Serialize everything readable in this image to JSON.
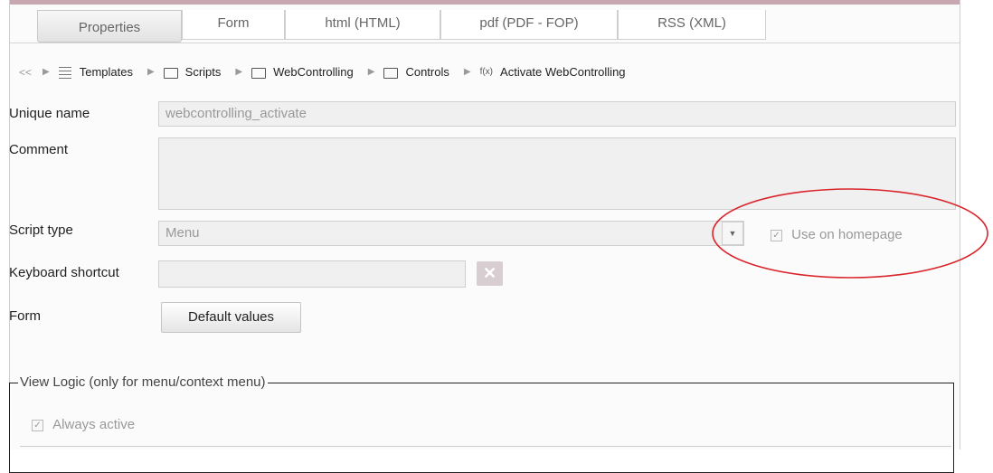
{
  "tabs": [
    "Properties",
    "Form",
    "html (HTML)",
    "pdf (PDF - FOP)",
    "RSS (XML)"
  ],
  "breadcrumb": {
    "nav_glyph": "<<",
    "items": [
      "Templates",
      "Scripts",
      "WebControlling",
      "Controls",
      "Activate WebControlling"
    ],
    "icons": [
      "templates-icon",
      "folder-icon",
      "folder-icon",
      "folder-icon",
      "script-icon"
    ],
    "fx_glyph": "f(x)"
  },
  "form": {
    "unique_name_label": "Unique name",
    "unique_name_value": "webcontrolling_activate",
    "comment_label": "Comment",
    "comment_value": "",
    "script_type_label": "Script type",
    "script_type_value": "Menu",
    "use_on_homepage_label": "Use on homepage",
    "use_on_homepage_checked": true,
    "keyboard_shortcut_label": "Keyboard shortcut",
    "keyboard_shortcut_value": "",
    "form_label": "Form",
    "default_values_button": "Default values"
  },
  "view_logic": {
    "legend": "View Logic (only for menu/context menu)",
    "always_active_label": "Always active",
    "always_active_checked": true
  },
  "colors": {
    "top_accent": "#c9a7b1",
    "annotation_ellipse": "#d9252b",
    "clear_button": "#d8cdd0"
  }
}
